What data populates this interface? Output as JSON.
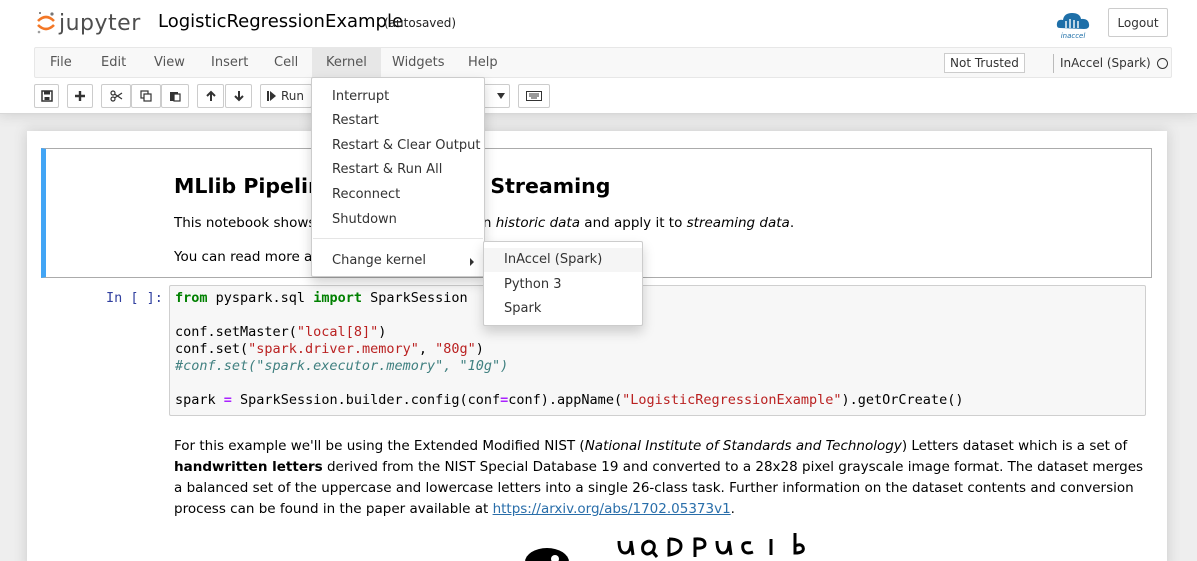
{
  "header": {
    "logo_text": "jupyter",
    "notebook_name": "LogisticRegressionExample",
    "autosave_status": "(autosaved)",
    "brand_logo": "inaccel",
    "logout_label": "Logout"
  },
  "menubar": {
    "items": [
      {
        "label": "File"
      },
      {
        "label": "Edit"
      },
      {
        "label": "View"
      },
      {
        "label": "Insert"
      },
      {
        "label": "Cell"
      },
      {
        "label": "Kernel"
      },
      {
        "label": "Widgets"
      },
      {
        "label": "Help"
      }
    ],
    "open_menu": "Kernel",
    "trust_label": "Not Trusted",
    "kernel_name": "InAccel (Spark)",
    "kernel_status_icon": "circle-icon"
  },
  "toolbar": {
    "buttons": [
      "save-icon",
      "plus-icon",
      "cut-icon",
      "copy-icon",
      "paste-icon",
      "arrow-up-icon",
      "arrow-down-icon",
      "run-button",
      "cell-type-select",
      "keyboard-icon"
    ],
    "run_label": "Run"
  },
  "kernel_menu": {
    "items": [
      {
        "label": "Interrupt"
      },
      {
        "label": "Restart"
      },
      {
        "label": "Restart & Clear Output"
      },
      {
        "label": "Restart & Run All"
      },
      {
        "label": "Reconnect"
      },
      {
        "label": "Shutdown"
      }
    ],
    "change_kernel_label": "Change kernel"
  },
  "kernel_submenu": {
    "items": [
      {
        "label": "InAccel (Spark)"
      },
      {
        "label": "Python 3"
      },
      {
        "label": "Spark"
      }
    ],
    "highlighted": "InAccel (Spark)"
  },
  "cells": {
    "md1": {
      "title": "MLlib Pipeline",
      "title_end": "d Streaming",
      "p1_start": "This notebook shows",
      "p1_em1": "historic data",
      "p1_mid": " and apply it to ",
      "p1_em2": "streaming data",
      "p1_end": ".",
      "p1_partial": "ne on ",
      "p2": "You can read more ab"
    },
    "code": {
      "prompt": "In [ ]:",
      "line1_kw1": "from",
      "line1_mod": " pyspark.sql ",
      "line1_kw2": "import",
      "line1_cls": " SparkSession",
      "line3_a": "conf.setMaster(",
      "line3_s": "\"local[8]\"",
      "line3_b": ")",
      "line4_a": "conf.set(",
      "line4_s1": "\"spark.driver.memory\"",
      "line4_c": ", ",
      "line4_s2": "\"80g\"",
      "line4_b": ")",
      "line5_comment": "#conf.set(\"spark.executor.memory\", \"10g\")",
      "line7_a": "spark ",
      "line7_eq": "=",
      "line7_b": " SparkSession.builder.config(conf",
      "line7_eq2": "=",
      "line7_c": "conf).appName(",
      "line7_s": "\"LogisticRegressionExample\"",
      "line7_d": ").getOrCreate()"
    },
    "md2": {
      "t1": "For this example we'll be using the Extended Modified NIST (",
      "t1_em": "National Institute of Standards and Technology",
      "t2": ") Letters dataset which is a set of ",
      "t2_b": "handwritten letters",
      "t3": " derived from the NIST Special Database 19 and converted to a 28x28 pixel grayscale image format. The dataset merges a balanced set of the uppercase and lowercase letters into a single 26-class task. Further information on the dataset contents and conversion process can be found in the paper available at ",
      "link": "https://arxiv.org/abs/1702.05373v1",
      "t4": "."
    },
    "handwriting_image": "handwritten-letters-sample"
  }
}
